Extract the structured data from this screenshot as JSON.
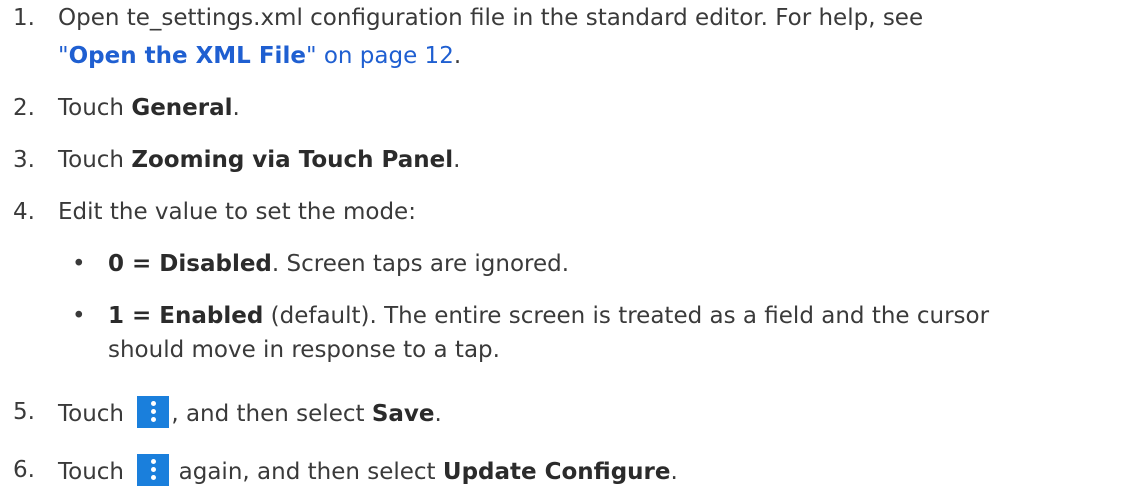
{
  "steps": {
    "s1": {
      "num": "1.",
      "line1": "Open te_settings.xml configuration file in the standard editor. For help, see",
      "link_quote_open": "\"",
      "link_bold": "Open the XML File",
      "link_quote_close": "\"",
      "link_tail": " on page 12",
      "end": "."
    },
    "s2": {
      "num": "2.",
      "pre": "Touch ",
      "bold": "General",
      "end": "."
    },
    "s3": {
      "num": "3.",
      "pre": "Touch ",
      "bold": "Zooming via Touch Panel",
      "end": "."
    },
    "s4": {
      "num": "4.",
      "text": "Edit the value to set the mode:",
      "bullets": [
        {
          "dot": "•",
          "bold": "0 = Disabled",
          "rest": ". Screen taps are ignored."
        },
        {
          "dot": "•",
          "bold": "1 = Enabled",
          "rest": " (default). The entire screen is treated as a field and the cursor",
          "line2": "should move in response to a tap."
        }
      ]
    },
    "s5": {
      "num": "5.",
      "pre": "Touch ",
      "mid": ", and then select ",
      "bold": "Save",
      "end": "."
    },
    "s6": {
      "num": "6.",
      "pre": "Touch ",
      "mid": " again, and then select ",
      "bold": "Update Configure",
      "end": "."
    }
  },
  "icons": {
    "menu": "more-vert-icon"
  },
  "colors": {
    "text": "#3a3a3a",
    "link": "#1f5fd1",
    "icon_bg": "#1a7fdc"
  }
}
